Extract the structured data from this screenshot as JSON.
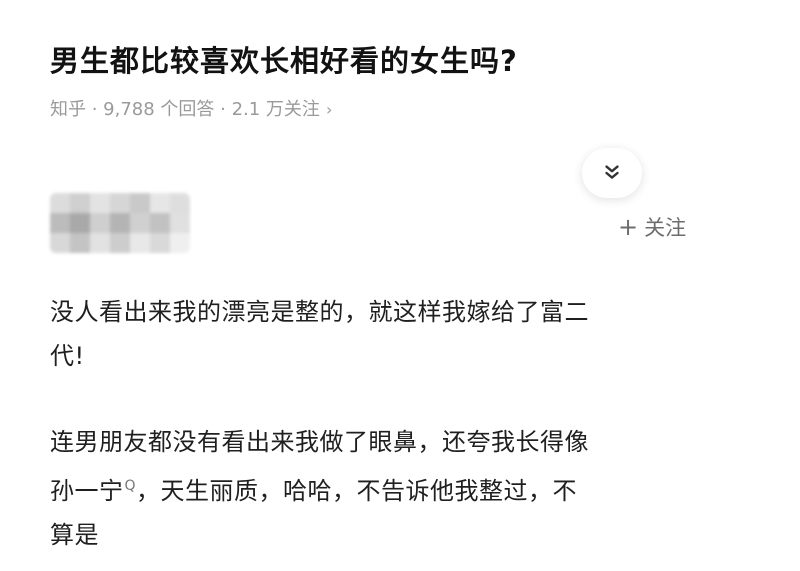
{
  "question": {
    "title": "男生都比较喜欢长相好看的女生吗?",
    "meta": "知乎 · 9,788 个回答 · 2.1 万关注",
    "meta_chevron": "›"
  },
  "actions": {
    "collapse_icon": "double-chevron-down-icon",
    "follow_plus": "+",
    "follow_label": "关注"
  },
  "author": {
    "avatar_icon": "blurred-avatar"
  },
  "answer": {
    "paragraph_1": {
      "line_1": "没人看出来我的漂亮是整的，就这样我嫁给了富二",
      "line_2": "代!"
    },
    "paragraph_2": {
      "line_1": "连男朋友都没有看出来我做了眼鼻，还夸我长得像",
      "line_2_a": "孙一宁",
      "line_2_ref": "Q",
      "line_2_b": "，天生丽质，哈哈，不告诉他我整过，不",
      "line_3": "算是"
    }
  },
  "colors": {
    "title": "#121212",
    "meta": "#9a9a9a",
    "body_text": "#1f1f1f",
    "follow": "#6d6d6d"
  }
}
